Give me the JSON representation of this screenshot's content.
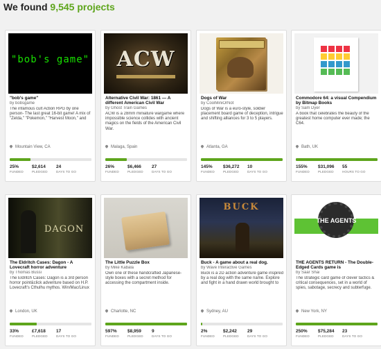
{
  "header": {
    "prefix": "We found",
    "count": "9,545 projects"
  },
  "projects": [
    {
      "title": "\"bob's game\"",
      "creator": "by bobsgame",
      "blurb": "The infamous cult Action RPG by one person- The last great 16-bit game! A mix of \"Zelda,\" \"Pokemon,\" \"Harvest Moon,\" and",
      "location": "Mountain View, CA",
      "funded_pct": 25,
      "stats": [
        {
          "value": "25%",
          "label": "FUNDED"
        },
        {
          "value": "$2,614",
          "label": "PLEDGED"
        },
        {
          "value": "24",
          "label": "DAYS TO GO"
        }
      ],
      "image_text": "\"bob's game\""
    },
    {
      "title": "Alternative Civil War: 1861 — A different American Civil War",
      "creator": "by Ghost Train Games",
      "blurb": "ACW is a 28mm miniature wargame where impossible science collides with ancient magics on the fields of the American Civil War.",
      "location": "Malaga, Spain",
      "funded_pct": 26,
      "stats": [
        {
          "value": "26%",
          "label": "FUNDED"
        },
        {
          "value": "$6,466",
          "label": "PLEDGED"
        },
        {
          "value": "27",
          "label": "DAYS TO GO"
        }
      ],
      "image_text": "ACW"
    },
    {
      "title": "Dogs of War",
      "creator": "by CoolMiniOrNot",
      "blurb": "Dogs of War is a euro-style, soldier placement board game of deception, intrigue and shifting alliances for 3 to 5 players.",
      "location": "Atlanta, GA",
      "funded_pct": 100,
      "stats": [
        {
          "value": "145%",
          "label": "FUNDED"
        },
        {
          "value": "$36,272",
          "label": "PLEDGED"
        },
        {
          "value": "10",
          "label": "DAYS TO GO"
        }
      ],
      "image_text": ""
    },
    {
      "title": "Commodore 64: a visual Compendium by Bitmap Books",
      "creator": "by Sam Dyer",
      "blurb": "A book that celebrates the beauty of the greatest home computer ever made; the C64.",
      "location": "Bath, UK",
      "funded_pct": 100,
      "stats": [
        {
          "value": "155%",
          "label": "FUNDED"
        },
        {
          "value": "$31,096",
          "label": "PLEDGED"
        },
        {
          "value": "55",
          "label": "HOURS TO GO"
        }
      ],
      "image_text": ""
    },
    {
      "title": "The Eldritch Cases: Dagon - A Lovecraft horror adventure",
      "creator": "by Thomas Bussi",
      "blurb": "The Eldritch Cases: Dagon is a 3rd person horror point&click adventure based on H.P. Lovecraft's Cthulhu mythos. Win/Mac/Linux",
      "location": "London, UK",
      "funded_pct": 33,
      "stats": [
        {
          "value": "33%",
          "label": "FUNDED"
        },
        {
          "value": "£7,618",
          "label": "PLEDGED"
        },
        {
          "value": "17",
          "label": "DAYS TO GO"
        }
      ],
      "image_text": "DAGON"
    },
    {
      "title": "The Little Puzzle Box",
      "creator": "by Mike Kabala",
      "blurb": "Own one of these handcrafted Japanese-style boxes with a secret method for accessing the compartment inside.",
      "location": "Charlotte, NC",
      "funded_pct": 100,
      "stats": [
        {
          "value": "597%",
          "label": "FUNDED"
        },
        {
          "value": "$8,959",
          "label": "PLEDGED"
        },
        {
          "value": "9",
          "label": "DAYS TO GO"
        }
      ],
      "image_text": ""
    },
    {
      "title": "Buck - A game about a real dog.",
      "creator": "by Wave Interactive Games",
      "blurb": "Buck is a 2D action adventure game inspired by a real dog with the same name. Explore and fight in a hand drawn world brought to",
      "location": "Sydney, AU",
      "funded_pct": 2,
      "stats": [
        {
          "value": "2%",
          "label": "FUNDED"
        },
        {
          "value": "$2,242",
          "label": "PLEDGED"
        },
        {
          "value": "29",
          "label": "DAYS TO GO"
        }
      ],
      "image_text": "BUCK"
    },
    {
      "title": "THE AGENTS RETURN - The Double-Edged Cards game is",
      "creator": "by Saar Shai",
      "blurb": "The strategic card game of clever tactics & critical consequences, set in a world of spies, sabotage, secrecy and subterfuge.",
      "location": "New York, NY",
      "funded_pct": 100,
      "stats": [
        {
          "value": "250%",
          "label": "FUNDED"
        },
        {
          "value": "$75,284",
          "label": "PLEDGED"
        },
        {
          "value": "23",
          "label": "DAYS TO GO"
        }
      ],
      "image_text": "THE AGENTS"
    }
  ],
  "colors": {
    "accent": "#5ea51c",
    "bar_bg": "#e5e5e5",
    "page_bg": "#f1f1f1"
  }
}
